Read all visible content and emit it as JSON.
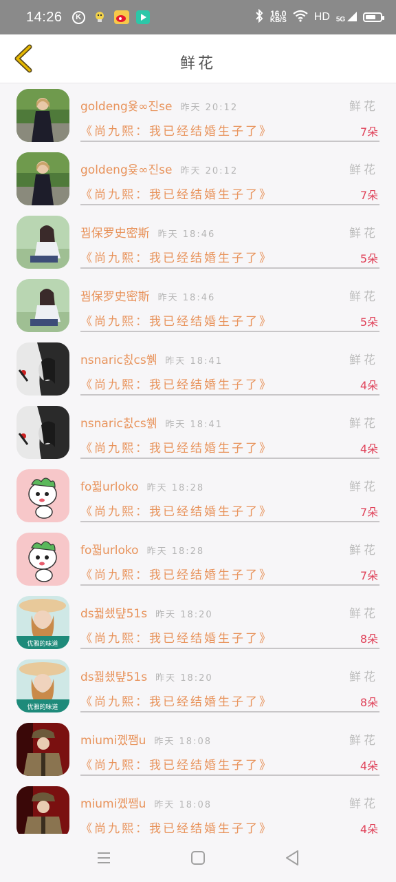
{
  "status": {
    "time": "14:26",
    "k_badge": "K",
    "speed_value": "16.0",
    "speed_unit": "KB/S",
    "hd": "HD",
    "network": "5G",
    "battery_level": 0.7
  },
  "header": {
    "title": "鲜花"
  },
  "list": {
    "items": [
      {
        "user": "goldeng윶∞진se",
        "time": "昨天 20:12",
        "type": "鲜花",
        "book": "《尚九熙：我已经结婚生子了》",
        "count": "7朵",
        "avatar": "girl-park"
      },
      {
        "user": "goldeng윶∞진se",
        "time": "昨天 20:12",
        "type": "鲜花",
        "book": "《尚九熙：我已经结婚生子了》",
        "count": "7朵",
        "avatar": "girl-park"
      },
      {
        "user": "꿤保罗史密斯",
        "time": "昨天 18:46",
        "type": "鲜花",
        "book": "《尚九熙：我已经结婚生子了》",
        "count": "5朵",
        "avatar": "girl-sitting"
      },
      {
        "user": "꿤保罗史密斯",
        "time": "昨天 18:46",
        "type": "鲜花",
        "book": "《尚九熙：我已经结婚生子了》",
        "count": "5朵",
        "avatar": "girl-sitting"
      },
      {
        "user": "nsnaric칤cs쒥",
        "time": "昨天 18:41",
        "type": "鲜花",
        "book": "《尚九熙：我已经结婚生子了》",
        "count": "4朵",
        "avatar": "bw-portrait"
      },
      {
        "user": "nsnaric칤cs쒥",
        "time": "昨天 18:41",
        "type": "鲜花",
        "book": "《尚九熙：我已经结婚生子了》",
        "count": "4朵",
        "avatar": "bw-portrait"
      },
      {
        "user": "fo꿟urloko",
        "time": "昨天 18:28",
        "type": "鲜花",
        "book": "《尚九熙：我已经结婚生子了》",
        "count": "7朵",
        "avatar": "cartoon"
      },
      {
        "user": "fo꿟urloko",
        "time": "昨天 18:28",
        "type": "鲜花",
        "book": "《尚九熙：我已经结婚生子了》",
        "count": "7朵",
        "avatar": "cartoon"
      },
      {
        "user": "ds꿟쇘턒51s",
        "time": "昨天 18:20",
        "type": "鲜花",
        "book": "《尚九熙：我已经结婚生子了》",
        "count": "8朵",
        "avatar": "girl-hat"
      },
      {
        "user": "ds꿟쇘턒51s",
        "time": "昨天 18:20",
        "type": "鲜花",
        "book": "《尚九熙：我已经结婚生子了》",
        "count": "8朵",
        "avatar": "girl-hat"
      },
      {
        "user": "miumi꼤쨈u",
        "time": "昨天 18:08",
        "type": "鲜花",
        "book": "《尚九熙：我已经结婚生子了》",
        "count": "4朵",
        "avatar": "officer"
      },
      {
        "user": "miumi꼤쨈u",
        "time": "昨天 18:08",
        "type": "鲜花",
        "book": "《尚九熙：我已经结婚生子了》",
        "count": "4朵",
        "avatar": "officer"
      }
    ]
  },
  "avatar_badge_text": "优雅的味道",
  "colors": {
    "accent": "#e8935b",
    "count": "#e0435a",
    "back_arrow": "#e6b800",
    "status_bar": "#8a8a8a"
  },
  "navbar": {
    "icons": [
      "menu-icon",
      "home-icon",
      "back-icon"
    ]
  }
}
